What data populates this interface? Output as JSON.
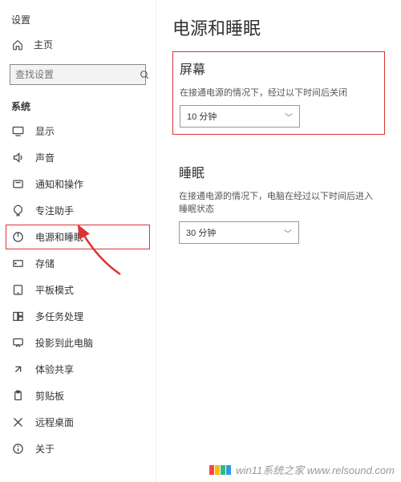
{
  "app_title": "设置",
  "home_label": "主页",
  "search": {
    "placeholder": "查找设置"
  },
  "section_label": "系统",
  "nav": [
    {
      "label": "显示"
    },
    {
      "label": "声音"
    },
    {
      "label": "通知和操作"
    },
    {
      "label": "专注助手"
    },
    {
      "label": "电源和睡眠"
    },
    {
      "label": "存储"
    },
    {
      "label": "平板模式"
    },
    {
      "label": "多任务处理"
    },
    {
      "label": "投影到此电脑"
    },
    {
      "label": "体验共享"
    },
    {
      "label": "剪贴板"
    },
    {
      "label": "远程桌面"
    },
    {
      "label": "关于"
    }
  ],
  "main": {
    "title": "电源和睡眠",
    "screen": {
      "title": "屏幕",
      "desc": "在接通电源的情况下，经过以下时间后关闭",
      "value": "10 分钟"
    },
    "sleep": {
      "title": "睡眠",
      "desc": "在接通电源的情况下，电脑在经过以下时间后进入睡眠状态",
      "value": "30 分钟"
    }
  },
  "watermark": "win11系统之家 www.relsound.com"
}
